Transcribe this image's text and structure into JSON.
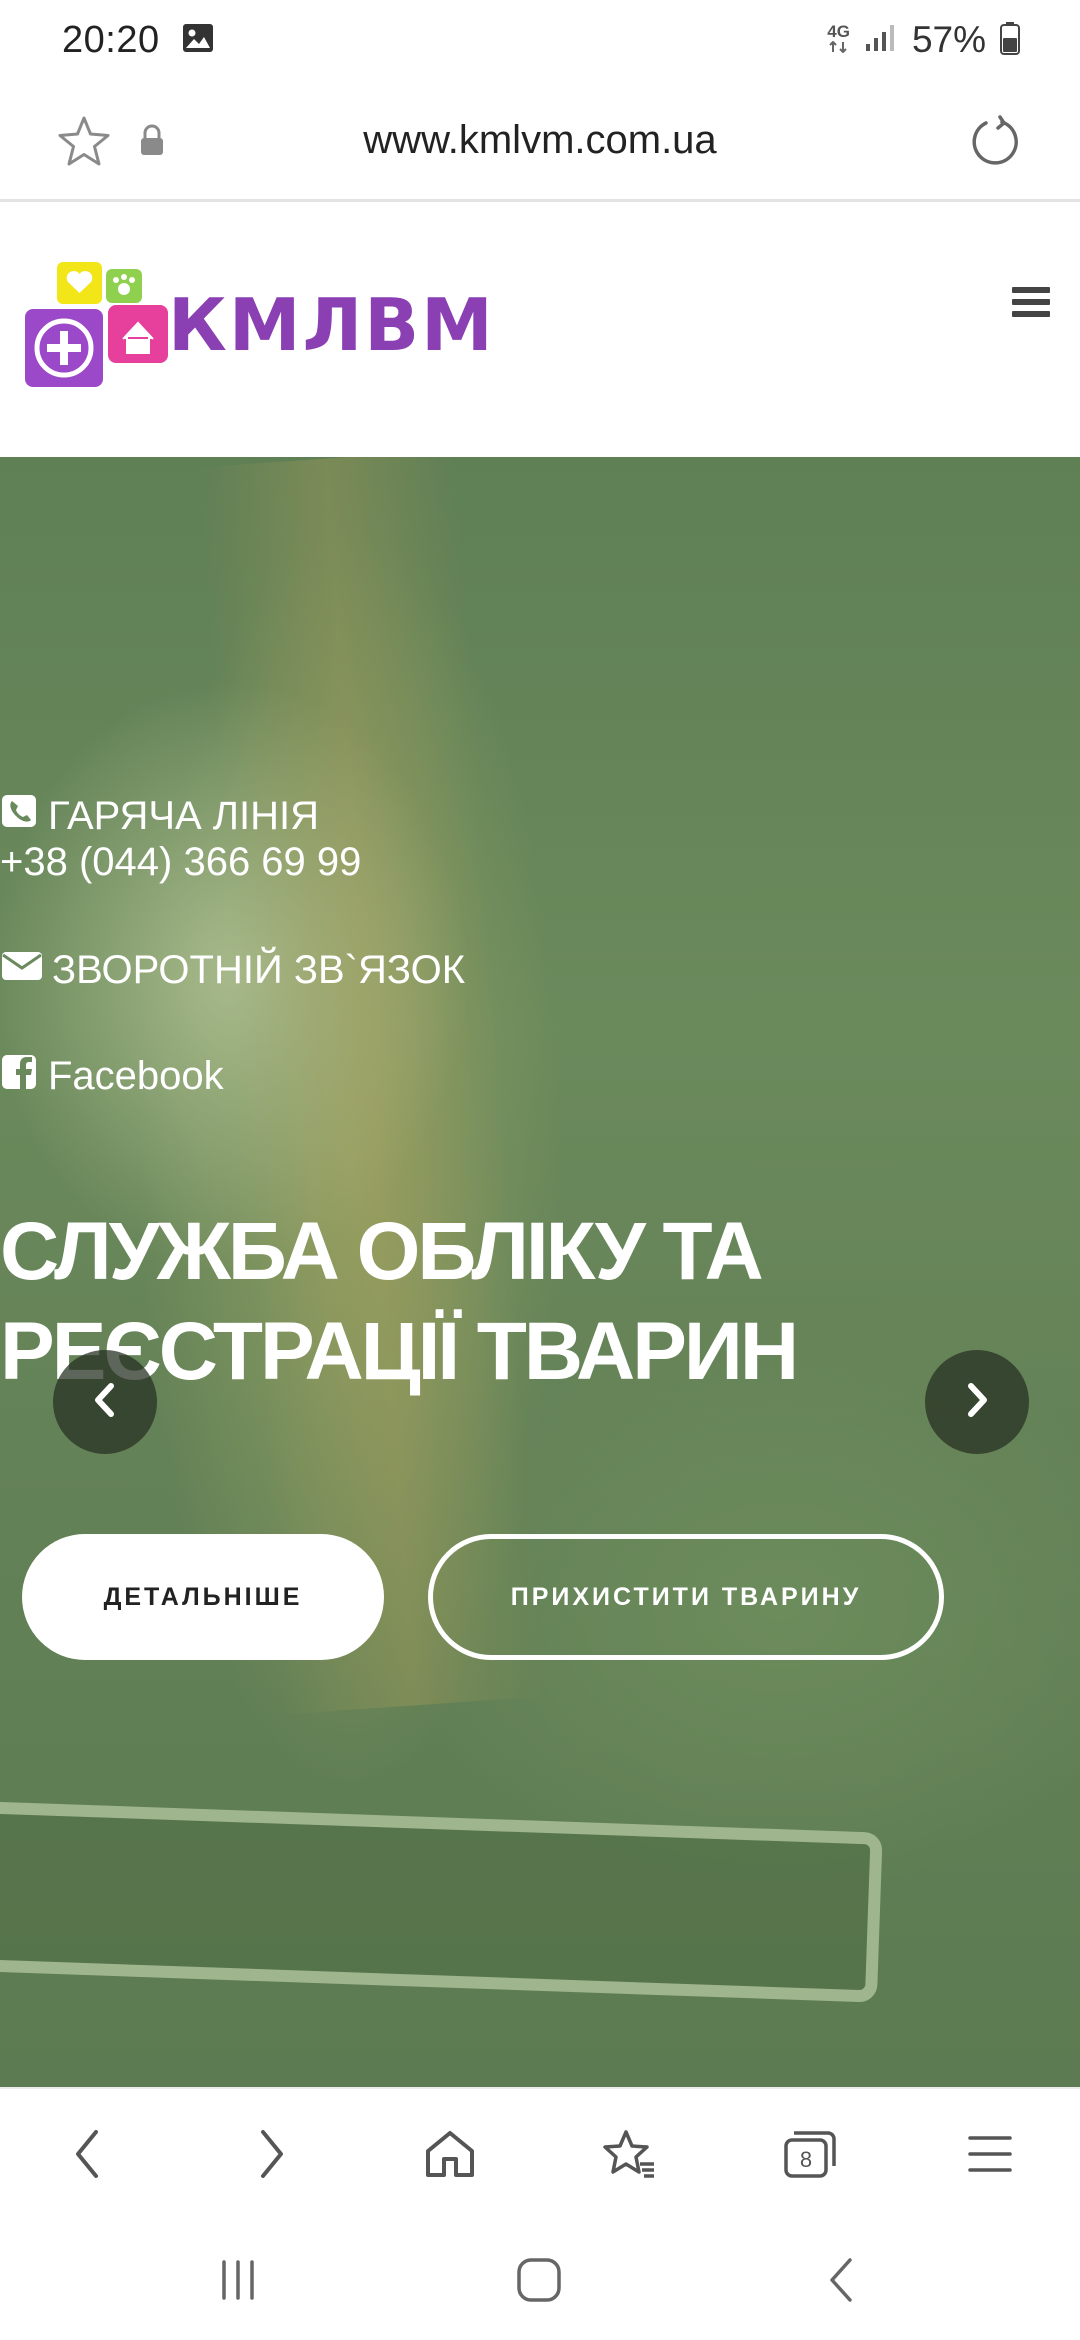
{
  "status_bar": {
    "time": "20:20",
    "network": "4G",
    "battery": "57%"
  },
  "browser": {
    "url": "www.kmlvm.com.ua",
    "tabs_count": "8"
  },
  "site": {
    "logo_text": "КМЛВМ",
    "brand_color": "#8a3fb3"
  },
  "hero": {
    "hotline_label": "ГАРЯЧА ЛІНІЯ",
    "hotline_phone": "+38 (044) 366 69 99",
    "feedback_label": "ЗВОРОТНІЙ ЗВ`ЯЗОК",
    "facebook_label": "Facebook",
    "title_line1": "СЛУЖБА ОБЛІКУ ТА",
    "title_line2": "РЕЄСТРАЦІЇ ТВАРИН",
    "details_button": "ДЕТАЛЬНІШЕ",
    "protect_button": "ПРИХИСТИТИ ТВАРИНУ"
  },
  "icons": {
    "status": [
      "gallery-icon",
      "signal-icon",
      "battery-icon"
    ],
    "address_bar": [
      "star-icon",
      "lock-icon",
      "reload-icon"
    ],
    "toolbar": [
      "back-icon",
      "forward-icon",
      "home-icon",
      "bookmarks-icon",
      "tabs-icon",
      "menu-icon"
    ],
    "system_nav": [
      "recents-icon",
      "home-button-icon",
      "system-back-icon"
    ]
  }
}
